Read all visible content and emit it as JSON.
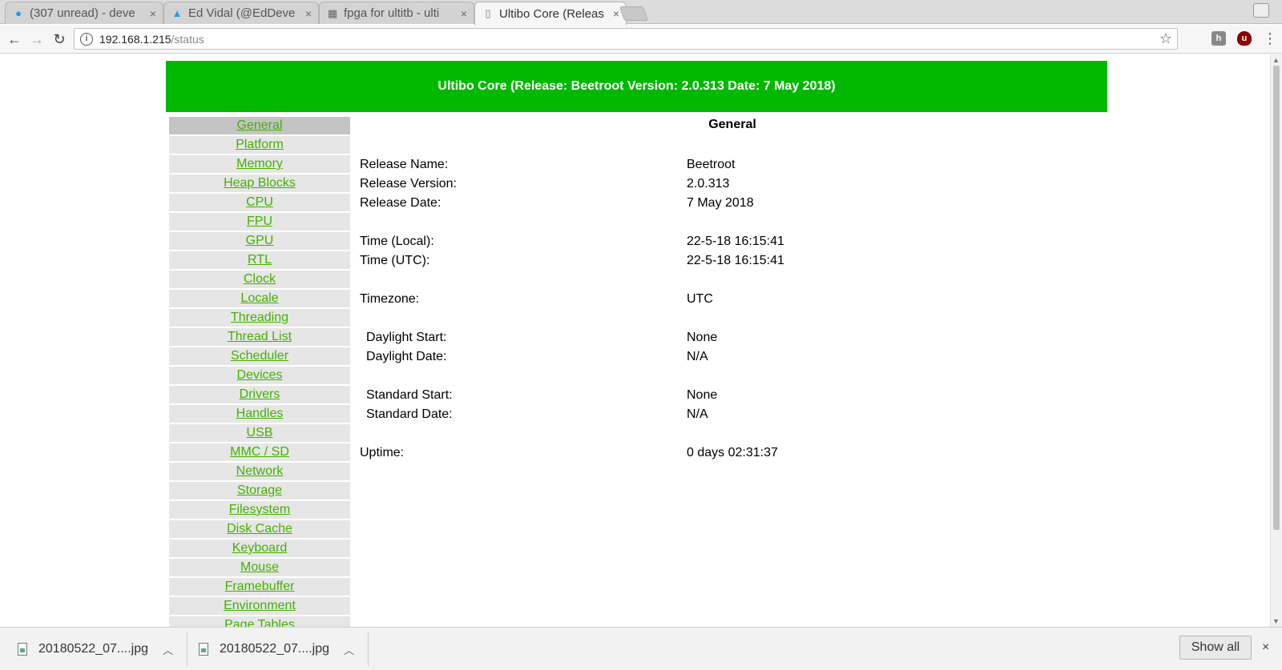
{
  "browser": {
    "tabs": [
      {
        "title": "(307 unread) - deve",
        "icon": "att-globe-icon"
      },
      {
        "title": "Ed Vidal (@EdDeve",
        "icon": "twitter-bird-icon"
      },
      {
        "title": "fpga for ultitb - ulti",
        "icon": "forum-icon"
      },
      {
        "title": "Ultibo Core (Releas",
        "icon": "document-icon"
      }
    ],
    "close_glyph": "×",
    "address": {
      "host": "192.168.1.215",
      "path": "/status"
    }
  },
  "page": {
    "banner": "Ultibo Core (Release: Beetroot Version: 2.0.313 Date: 7 May 2018)",
    "nav": [
      "General",
      "Platform",
      "Memory",
      "Heap Blocks",
      "CPU",
      "FPU",
      "GPU",
      "RTL",
      "Clock",
      "Locale",
      "Threading",
      "Thread List",
      "Scheduler",
      "Devices",
      "Drivers",
      "Handles",
      "USB",
      "MMC / SD",
      "Network",
      "Storage",
      "Filesystem",
      "Disk Cache",
      "Keyboard",
      "Mouse",
      "Framebuffer",
      "Environment",
      "Page Tables"
    ],
    "selected_nav": "General",
    "section_title": "General",
    "rows": {
      "release_name": {
        "label": "Release Name:",
        "value": "Beetroot"
      },
      "release_version": {
        "label": "Release Version:",
        "value": "2.0.313"
      },
      "release_date": {
        "label": "Release Date:",
        "value": "7 May 2018"
      },
      "time_local": {
        "label": "Time (Local):",
        "value": "22-5-18 16:15:41"
      },
      "time_utc": {
        "label": "Time (UTC):",
        "value": "22-5-18 16:15:41"
      },
      "timezone": {
        "label": "Timezone:",
        "value": "UTC"
      },
      "daylight_start": {
        "label": "Daylight Start:",
        "value": "None"
      },
      "daylight_date": {
        "label": "Daylight Date:",
        "value": "N/A"
      },
      "standard_start": {
        "label": "Standard Start:",
        "value": "None"
      },
      "standard_date": {
        "label": "Standard Date:",
        "value": "N/A"
      },
      "uptime": {
        "label": "Uptime:",
        "value": "0 days 02:31:37"
      }
    }
  },
  "downloads": {
    "items": [
      "20180522_07....jpg",
      "20180522_07....jpg"
    ],
    "show_all": "Show all"
  },
  "colors": {
    "banner": "#00b800",
    "link": "#44b000",
    "nav_bg": "#e6e6e6",
    "nav_selected": "#c4c4c4"
  }
}
